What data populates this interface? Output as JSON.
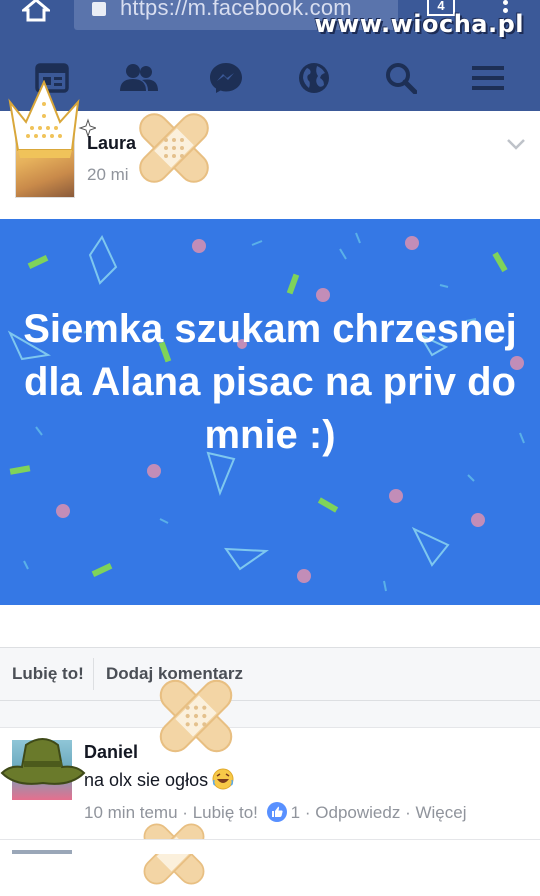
{
  "browser": {
    "url": "https://m.facebook.com",
    "tabs_count": "4",
    "watermark": "www.wiocha.pl"
  },
  "post": {
    "author": "Laura",
    "time": "20 mi",
    "status_text": "Siemka szukam chrzesnej dla Alana pisac na priv do mnie :)",
    "status_bg": "#3578e5"
  },
  "actions": {
    "like_label": "Lubię to!",
    "comment_label": "Dodaj komentarz"
  },
  "comment": {
    "author": "Daniel",
    "text": "na olx sie ogłos",
    "time": "10 min temu",
    "like_label": "Lubię to!",
    "like_count": "1",
    "reply_label": "Odpowiedz",
    "more_label": "Więcej",
    "sep": "·"
  },
  "icons": {
    "nav": [
      "feed-icon",
      "friends-icon",
      "messenger-icon",
      "globe-icon",
      "search-icon",
      "menu-icon"
    ]
  }
}
